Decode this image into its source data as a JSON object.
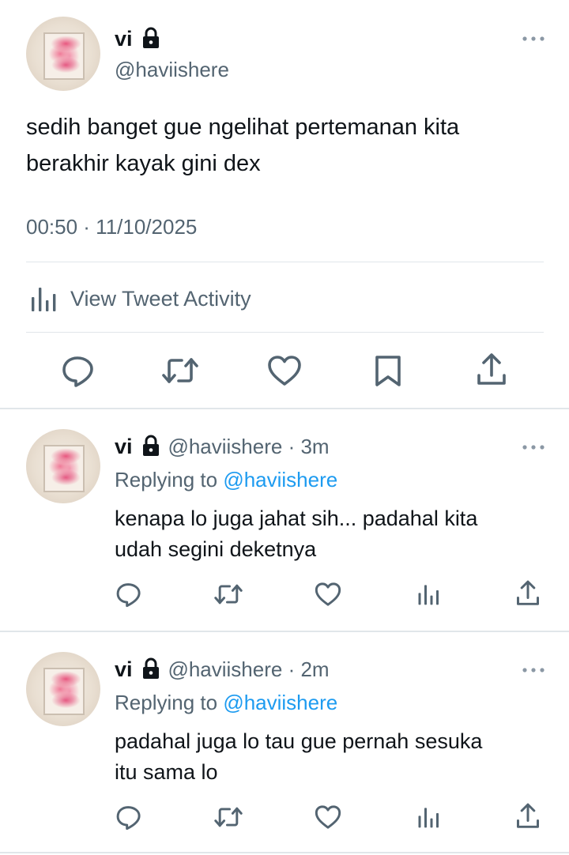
{
  "main_tweet": {
    "display_name": "vi",
    "handle": "@haviishere",
    "text_line1": "sedih banget gue ngelihat pertemanan kita",
    "text_line2": "berakhir kayak gini dex",
    "timestamp": "00:50 · 11/10/2025",
    "activity_label": "View Tweet Activity"
  },
  "replies": [
    {
      "display_name": "vi",
      "handle_time": "@haviishere · 3m",
      "replying_prefix": "Replying to",
      "replying_handle": "@haviishere",
      "text_line1": "kenapa lo juga jahat sih... padahal kita",
      "text_line2": "udah segini deketnya"
    },
    {
      "display_name": "vi",
      "handle_time": "@haviishere · 2m",
      "replying_prefix": "Replying to",
      "replying_handle": "@haviishere",
      "text_line1": "padahal juga lo tau gue pernah sesuka",
      "text_line2": "itu sama lo"
    }
  ],
  "icons": {
    "lock": "lock-icon",
    "more": "more-icon",
    "activity": "bar-chart-icon",
    "reply": "reply-icon",
    "retweet": "retweet-icon",
    "like": "heart-icon",
    "bookmark": "bookmark-icon",
    "share": "share-icon"
  },
  "colors": {
    "text": "#0f1419",
    "secondary": "#536471",
    "link": "#1d9bf0",
    "divider": "#e1e6ea"
  }
}
